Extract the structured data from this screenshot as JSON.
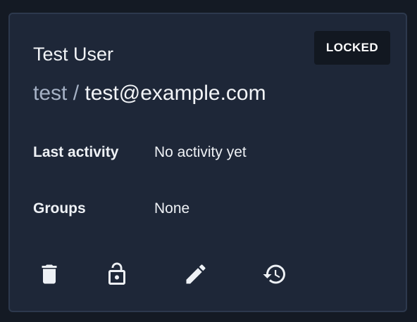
{
  "user": {
    "display_name": "Test User",
    "username": "test",
    "separator": "/",
    "email": "test@example.com",
    "status_badge": "LOCKED"
  },
  "details": [
    {
      "label": "Last activity",
      "value": "No activity yet"
    },
    {
      "label": "Groups",
      "value": "None"
    }
  ],
  "actions": [
    {
      "icon": "trash-icon"
    },
    {
      "icon": "unlock-icon"
    },
    {
      "icon": "pencil-icon"
    },
    {
      "icon": "history-icon"
    }
  ],
  "colors": {
    "background": "#141a24",
    "card": "#1e2738",
    "card_border": "#2d394d",
    "badge_bg": "#121821",
    "text": "#eef1f5",
    "muted_text": "#a5b1c5"
  }
}
